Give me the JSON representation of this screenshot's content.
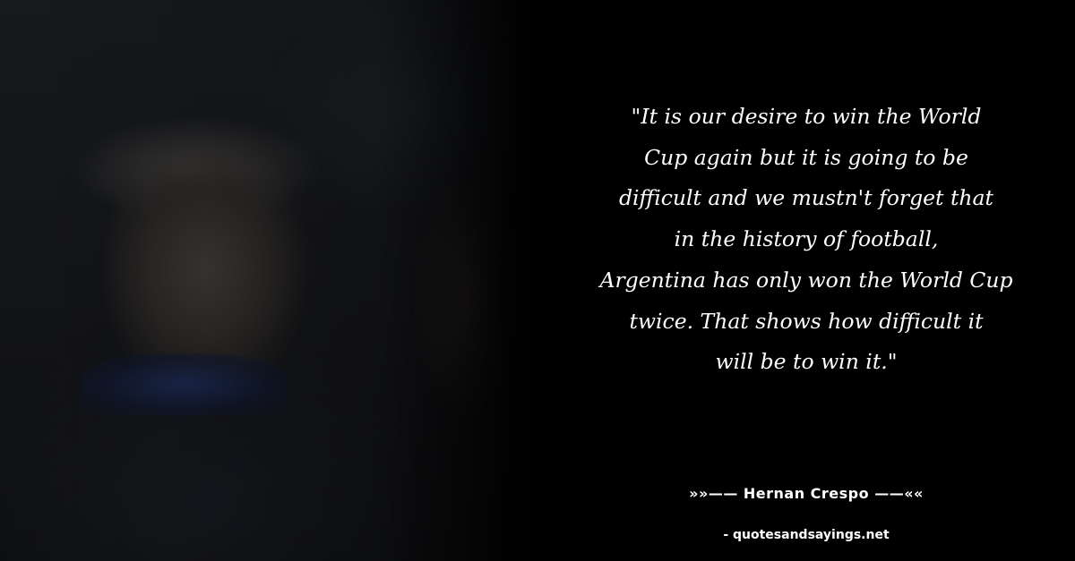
{
  "quote": {
    "text": "\"It is our desire to win the World\nCup again but it is going to be\ndifficult and we mustn't forget that\nin the history of football,\nArgentina has only won the World Cup\ntwice. That shows how difficult it\nwill be to win it.\""
  },
  "attribution": {
    "author_line": "»»—— Hernan Crespo ——««"
  },
  "footer": {
    "source": "- quotesandsayings.net"
  },
  "colors": {
    "background": "#000000",
    "text": "#ffffff"
  }
}
